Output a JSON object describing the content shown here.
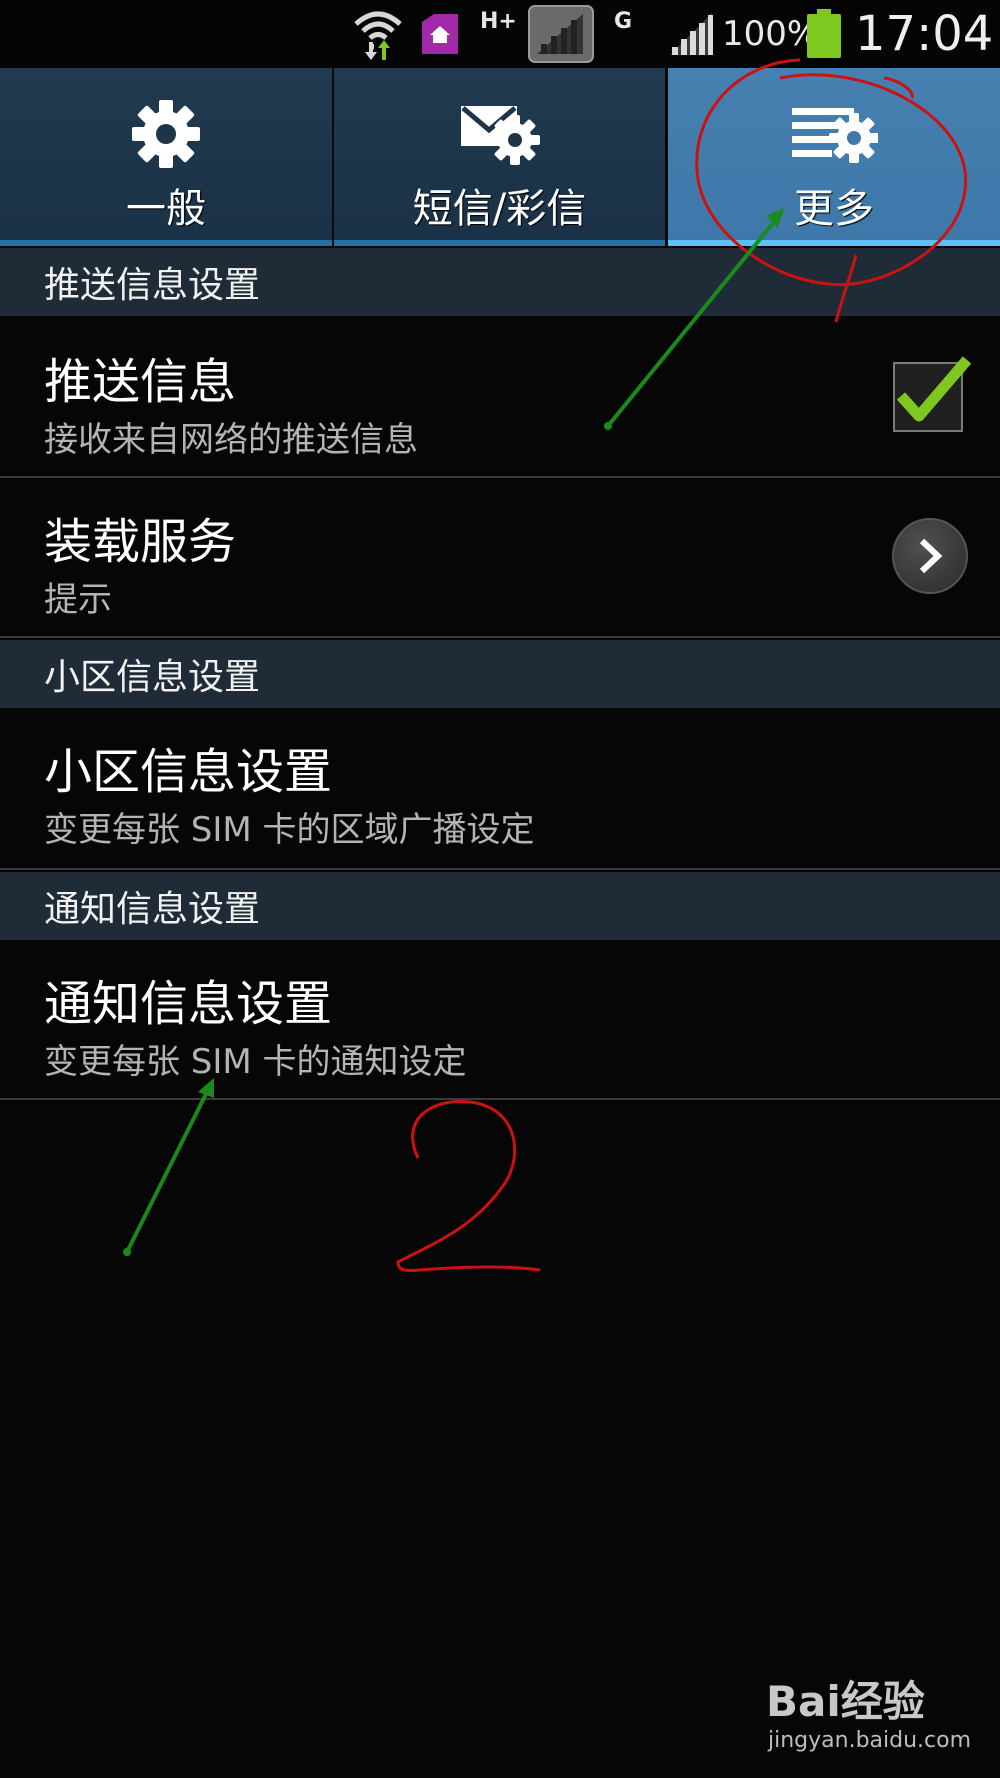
{
  "status_bar": {
    "network_type": "H+",
    "network_type_2": "G",
    "battery_percent": "100%",
    "time": "17:04",
    "icons": [
      "wifi-icon",
      "home-icon",
      "sim-signal-icon",
      "signal-icon",
      "battery-icon"
    ]
  },
  "tabs": [
    {
      "label": "一般",
      "icon": "gear-icon",
      "selected": false
    },
    {
      "label": "短信/彩信",
      "icon": "message-settings-icon",
      "selected": false
    },
    {
      "label": "更多",
      "icon": "more-settings-icon",
      "selected": true
    }
  ],
  "sections": [
    {
      "header": "推送信息设置",
      "items": [
        {
          "title": "推送信息",
          "subtitle": "接收来自网络的推送信息",
          "control": "checkbox",
          "checked": true
        },
        {
          "title": "装载服务",
          "subtitle": "提示",
          "control": "chevron"
        }
      ]
    },
    {
      "header": "小区信息设置",
      "items": [
        {
          "title": "小区信息设置",
          "subtitle": "变更每张 SIM 卡的区域广播设定"
        }
      ]
    },
    {
      "header": "通知信息设置",
      "items": [
        {
          "title": "通知信息设置",
          "subtitle": "变更每张 SIM 卡的通知设定"
        }
      ]
    }
  ],
  "annotations": {
    "circle_label": "1",
    "handwritten_label": "2",
    "circle_color": "#cc1111",
    "arrow_color": "#1a8a1a"
  },
  "watermark": {
    "logo_text": "Bai经验",
    "url": "jingyan.baidu.com"
  },
  "colors": {
    "tab_bg": "#1f3850",
    "tab_selected_bg": "#4480b0",
    "section_header_bg": "#1f2c37",
    "checkmark": "#7ec820",
    "battery": "#7ec820"
  }
}
